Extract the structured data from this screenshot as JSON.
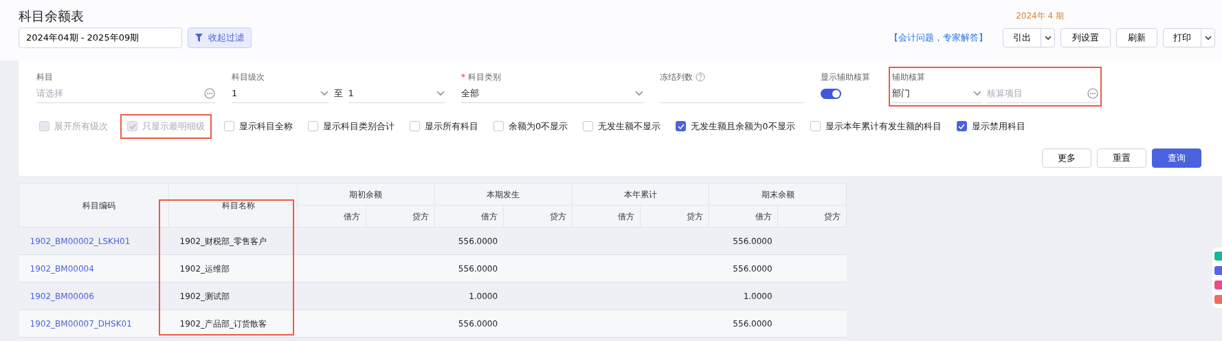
{
  "page": {
    "title": "科目余额表",
    "period": "2024年 4 期"
  },
  "toolbar": {
    "date_range": "2024年04期 - 2025年09期",
    "filter_toggle": "收起过滤",
    "help_link": "【会计问题，专家解答】",
    "buttons": [
      {
        "label": "引出",
        "dropdown": true
      },
      {
        "label": "列设置",
        "dropdown": false
      },
      {
        "label": "刷新",
        "dropdown": false
      },
      {
        "label": "打印",
        "dropdown": true
      }
    ]
  },
  "filters": {
    "fields": [
      {
        "kind": "picker",
        "label": "科目",
        "placeholder": "请选择",
        "highlighted": false
      },
      {
        "kind": "range",
        "label": "科目级次",
        "value": "1",
        "separator": "至",
        "value_to": "1",
        "highlighted": false
      },
      {
        "kind": "select",
        "label": "科目类别",
        "required_mark": "*",
        "value": "全部",
        "highlighted": false
      },
      {
        "kind": "number",
        "label": "冻结列数",
        "highlighted": false
      },
      {
        "kind": "switch",
        "label": "显示辅助核算",
        "on": true,
        "highlighted": false
      },
      {
        "kind": "aux",
        "label": "辅助核算",
        "value": "部门",
        "placeholder": "核算项目",
        "highlighted": true
      }
    ],
    "options": [
      {
        "label": "展开所有级次",
        "checked": false,
        "disabled": true,
        "highlighted": false
      },
      {
        "label": "只显示最明细级",
        "checked": true,
        "disabled": true,
        "highlighted": true
      },
      {
        "label": "显示科目全称",
        "checked": false,
        "disabled": false,
        "highlighted": false
      },
      {
        "label": "显示科目类别合计",
        "checked": false,
        "disabled": false,
        "highlighted": false
      },
      {
        "label": "显示所有科目",
        "checked": false,
        "disabled": false,
        "highlighted": false
      },
      {
        "label": "余额为0不显示",
        "checked": false,
        "disabled": false,
        "highlighted": false
      },
      {
        "label": "无发生额不显示",
        "checked": false,
        "disabled": false,
        "highlighted": false
      },
      {
        "label": "无发生额且余额为0不显示",
        "checked": true,
        "disabled": false,
        "highlighted": false
      },
      {
        "label": "显示本年累计有发生额的科目",
        "checked": false,
        "disabled": false,
        "highlighted": false
      },
      {
        "label": "显示禁用科目",
        "checked": true,
        "disabled": false,
        "highlighted": false
      }
    ],
    "actions": [
      {
        "label": "更多",
        "primary": false
      },
      {
        "label": "重置",
        "primary": false
      },
      {
        "label": "查询",
        "primary": true
      }
    ]
  },
  "table": {
    "columns": [
      {
        "label": "科目编码",
        "highlighted": false
      },
      {
        "label": "科目名称",
        "highlighted": true
      }
    ],
    "groups": [
      {
        "label": "期初余额",
        "subcolumns": [
          "借方",
          "贷方"
        ]
      },
      {
        "label": "本期发生",
        "subcolumns": [
          "借方",
          "贷方"
        ]
      },
      {
        "label": "本年累计",
        "subcolumns": [
          "借方",
          "贷方"
        ]
      },
      {
        "label": "期末余额",
        "subcolumns": [
          "借方",
          "贷方"
        ]
      }
    ],
    "rows": [
      {
        "code": "1902_BM00002_LSKH01",
        "name": "1902_财税部_零售客户",
        "period_debit": "556.0000",
        "closing_debit": "556.0000"
      },
      {
        "code": "1902_BM00004",
        "name": "1902_运维部",
        "period_debit": "556.0000",
        "closing_debit": "556.0000"
      },
      {
        "code": "1902_BM00006",
        "name": "1902_测试部",
        "period_debit": "1.0000",
        "closing_debit": "1.0000"
      },
      {
        "code": "1902_BM00007_DHSK01",
        "name": "1902_产品部_订货散客",
        "period_debit": "556.0000",
        "closing_debit": "556.0000"
      }
    ]
  }
}
